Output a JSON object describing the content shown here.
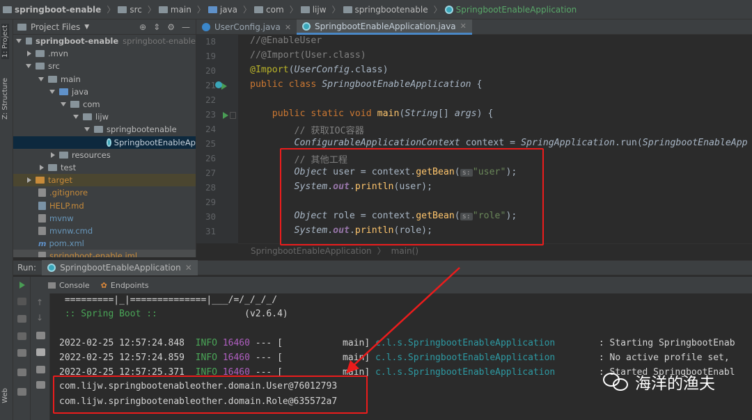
{
  "breadcrumb": {
    "items": [
      "springboot-enable",
      "src",
      "main",
      "java",
      "com",
      "lijw",
      "springbootenable",
      "SpringbootEnableApplication"
    ]
  },
  "sidebar_tabs": {
    "project": "1: Project",
    "structure": "Z: Structure",
    "web": "Web"
  },
  "project": {
    "header": "Project Files",
    "tree": [
      {
        "label": "springboot-enable",
        "extra": "springboot-enable"
      },
      {
        "label": ".mvn"
      },
      {
        "label": "src"
      },
      {
        "label": "main"
      },
      {
        "label": "java"
      },
      {
        "label": "com"
      },
      {
        "label": "lijw"
      },
      {
        "label": "springbootenable"
      },
      {
        "label": "SpringbootEnableAp"
      },
      {
        "label": "resources"
      },
      {
        "label": "test"
      },
      {
        "label": "target"
      },
      {
        "label": ".gitignore"
      },
      {
        "label": "HELP.md"
      },
      {
        "label": "mvnw"
      },
      {
        "label": "mvnw.cmd"
      },
      {
        "label": "pom.xml"
      },
      {
        "label": "springboot-enable.iml"
      }
    ]
  },
  "editor": {
    "tabs": [
      {
        "label": "UserConfig.java"
      },
      {
        "label": "SpringbootEnableApplication.java"
      }
    ],
    "line_numbers": [
      "18",
      "19",
      "20",
      "21",
      "22",
      "23",
      "24",
      "25",
      "26",
      "27",
      "28",
      "29",
      "30",
      "31"
    ],
    "code": {
      "l18": "//@EnableUser",
      "l19": "//@Import(User.class)",
      "l20_ann": "@Import",
      "l20_arg": "UserConfig",
      "l20_tail": ".class)",
      "l21_kw": "public class ",
      "l21_name": "SpringbootEnableApplication",
      "l21_tail": " {",
      "l23_kw": "public static void ",
      "l23_fn": "main",
      "l23_type": "String",
      "l23_arr": "[] ",
      "l23_param": "args",
      "l23_tail": ") {",
      "l24": "// 获取IOC容器",
      "l25_type": "ConfigurableApplicationContext",
      "l25_var": " context = ",
      "l25_cls": "SpringApplication",
      "l25_m": ".run(",
      "l25_arg": "SpringbootEnableApp",
      "l26": "// 其他工程",
      "l27_type": "Object",
      "l27_mid": " user = context.",
      "l27_m": "getBean",
      "l27_hint": "s:",
      "l27_str": "\"user\"",
      "l27_tail": ");",
      "l28_cls": "System",
      "l28_out": "out",
      "l28_m": "println",
      "l28_tail": "(user);",
      "l30_type": "Object",
      "l30_mid": " role = context.",
      "l30_m": "getBean",
      "l30_hint": "s:",
      "l30_str": "\"role\"",
      "l30_tail": ");",
      "l31_cls": "System",
      "l31_out": "out",
      "l31_m": "println",
      "l31_tail": "(role);"
    },
    "crumbs": [
      "SpringbootEnableApplication",
      "main()"
    ]
  },
  "run": {
    "label": "Run:",
    "tab": "SpringbootEnableApplication",
    "subtabs": [
      "Console",
      "Endpoints"
    ],
    "console": {
      "banner1": " =========|_|==============|___/=/_/_/_/",
      "banner2_a": " :: Spring Boot :: ",
      "banner2_b": "               (v2.6.4)",
      "logs": [
        {
          "ts": "2022-02-25 12:57:24.848",
          "level": "INFO",
          "pid": "16460",
          "sep": " --- [           main]",
          "logger": " c.l.s.SpringbootEnableApplication",
          "msg": "        : Starting SpringbootEnab"
        },
        {
          "ts": "2022-02-25 12:57:24.859",
          "level": "INFO",
          "pid": "16460",
          "sep": " --- [           main]",
          "logger": " c.l.s.SpringbootEnableApplication",
          "msg": "        : No active profile set,"
        },
        {
          "ts": "2022-02-25 12:57:25.371",
          "level": "INFO",
          "pid": "16460",
          "sep": " --- [           main]",
          "logger": " c.l.s.SpringbootEnableApplication",
          "msg": "        : Started SpringbootEnabl"
        }
      ],
      "out1": "com.lijw.springbootenableother.domain.User@76012793",
      "out2": "com.lijw.springbootenableother.domain.Role@635572a7"
    }
  },
  "watermark": "海洋的渔夫",
  "colors": {
    "highlight": "#ec1c1c",
    "accent": "#4a88c7"
  }
}
